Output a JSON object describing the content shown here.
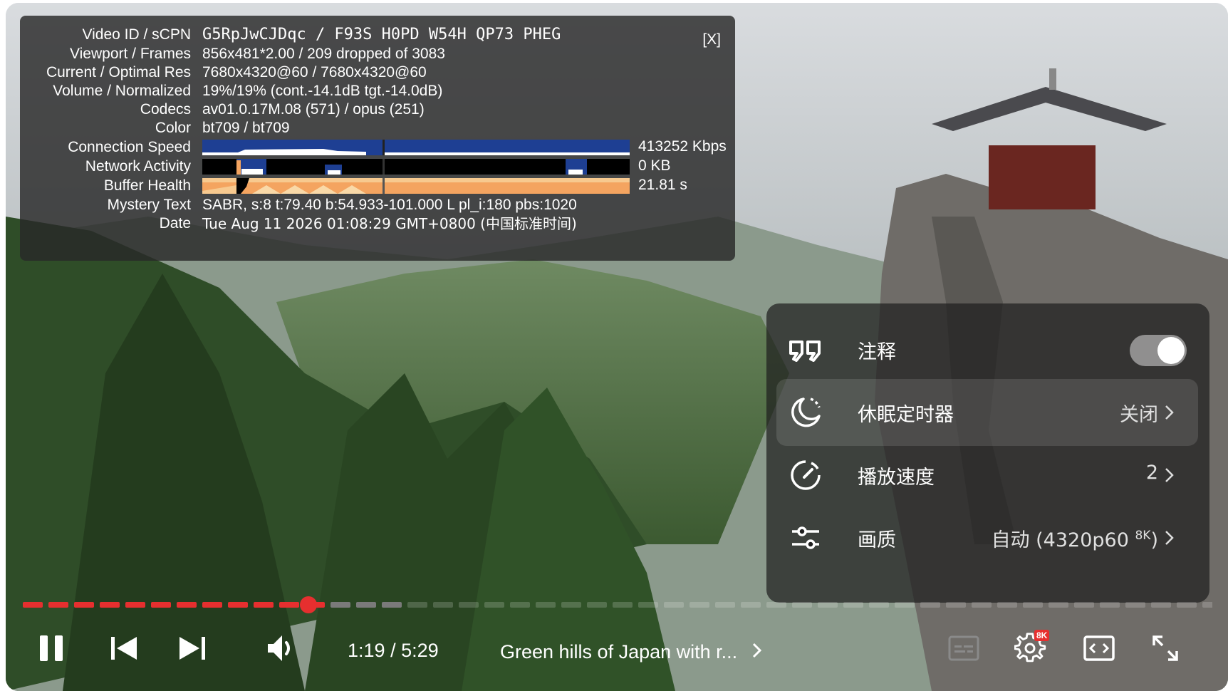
{
  "stats": {
    "close_label": "[X]",
    "rows": [
      {
        "label": "Video ID / sCPN",
        "value": "G5RpJwCJDqc / F93S H0PD W54H QP73 PHEG"
      },
      {
        "label": "Viewport / Frames",
        "value": "856x481*2.00 / 209 dropped of 3083"
      },
      {
        "label": "Current / Optimal Res",
        "value": "7680x4320@60 / 7680x4320@60"
      },
      {
        "label": "Volume / Normalized",
        "value": "19%/19% (cont.-14.1dB tgt.-14.0dB)"
      },
      {
        "label": "Codecs",
        "value": "av01.0.17M.08 (571) / opus (251)"
      },
      {
        "label": "Color",
        "value": "bt709 / bt709"
      },
      {
        "label": "Connection Speed",
        "value": "413252 Kbps"
      },
      {
        "label": "Network Activity",
        "value": "0 KB"
      },
      {
        "label": "Buffer Health",
        "value": "21.81 s"
      },
      {
        "label": "Mystery Text",
        "value": "SABR, s:8 t:79.40 b:54.933-101.000 L pl_i:180 pbs:1020"
      },
      {
        "label": "Date",
        "value": "Tue Aug 11 2026 01:08:29 GMT+0800 (中国标准时间)"
      }
    ]
  },
  "settings_menu": {
    "items": [
      {
        "label": "注释",
        "type": "toggle",
        "on": true,
        "icon": "annotations-icon"
      },
      {
        "label": "休眠定时器",
        "value": "关闭",
        "icon": "sleep-timer-icon"
      },
      {
        "label": "播放速度",
        "value": "2",
        "icon": "playback-speed-icon"
      },
      {
        "label": "画质",
        "value": "自动 (4320p60 ",
        "value_sup": "8K",
        "value_tail": ")",
        "icon": "quality-icon"
      }
    ]
  },
  "player": {
    "time_current": "1:19",
    "time_separator": " / ",
    "time_total": "5:29",
    "title": "Green hills of Japan with r...",
    "progress_fraction": 0.24,
    "buffered_fraction": 0.31,
    "settings_badge": "8K",
    "colors": {
      "progress": "#e62f2f",
      "buffer_bar": "#7a7a7a",
      "stats_bg": "#282828",
      "conn_graph": "#1e3f93",
      "buffer_graph": "#f4a460"
    }
  }
}
